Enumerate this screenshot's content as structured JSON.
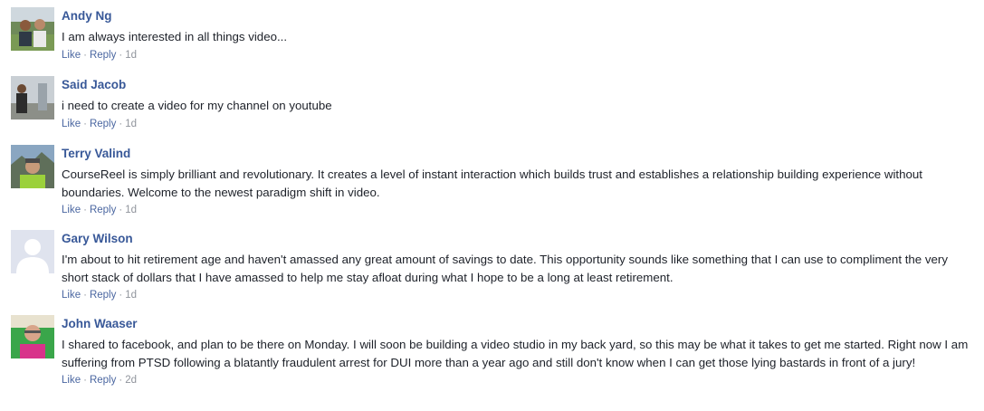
{
  "comments": [
    {
      "author": "Andy Ng",
      "text": "I am always interested in all things video...",
      "like_label": "Like",
      "reply_label": "Reply",
      "separator": "·",
      "time": "1d",
      "avatar": "profile-photo-avatar"
    },
    {
      "author": "Said Jacob",
      "text": "i need to create a video for my channel on youtube",
      "like_label": "Like",
      "reply_label": "Reply",
      "separator": "·",
      "time": "1d",
      "avatar": "profile-photo-avatar"
    },
    {
      "author": "Terry Valind",
      "text": "CourseReel is simply brilliant and revolutionary. It creates a level of instant interaction which builds trust and establishes a relationship building experience without boundaries. Welcome to the newest paradigm shift in video.",
      "like_label": "Like",
      "reply_label": "Reply",
      "separator": "·",
      "time": "1d",
      "avatar": "profile-photo-avatar"
    },
    {
      "author": "Gary Wilson",
      "text": "I'm about to hit retirement age and haven't amassed any great amount of savings to date. This opportunity sounds like something that I can use to compliment the very short stack of dollars that I have amassed to help me stay afloat during what I hope to be a long at least retirement.",
      "like_label": "Like",
      "reply_label": "Reply",
      "separator": "·",
      "time": "1d",
      "avatar": "default-silhouette-avatar"
    },
    {
      "author": "John Waaser",
      "text": "I shared to facebook, and plan to be there on Monday. I will soon be building a video studio in my back yard, so this may be what it takes to get me started. Right now I am suffering from PTSD following a blatantly fraudulent arrest for DUI more than a year ago and still don't know when I can get those lying bastards in front of a jury!",
      "like_label": "Like",
      "reply_label": "Reply",
      "separator": "·",
      "time": "2d",
      "avatar": "profile-photo-avatar"
    }
  ],
  "colors": {
    "author": "#385898",
    "action_link": "#4b67a1",
    "meta": "#90949c",
    "text": "#1d2129"
  }
}
